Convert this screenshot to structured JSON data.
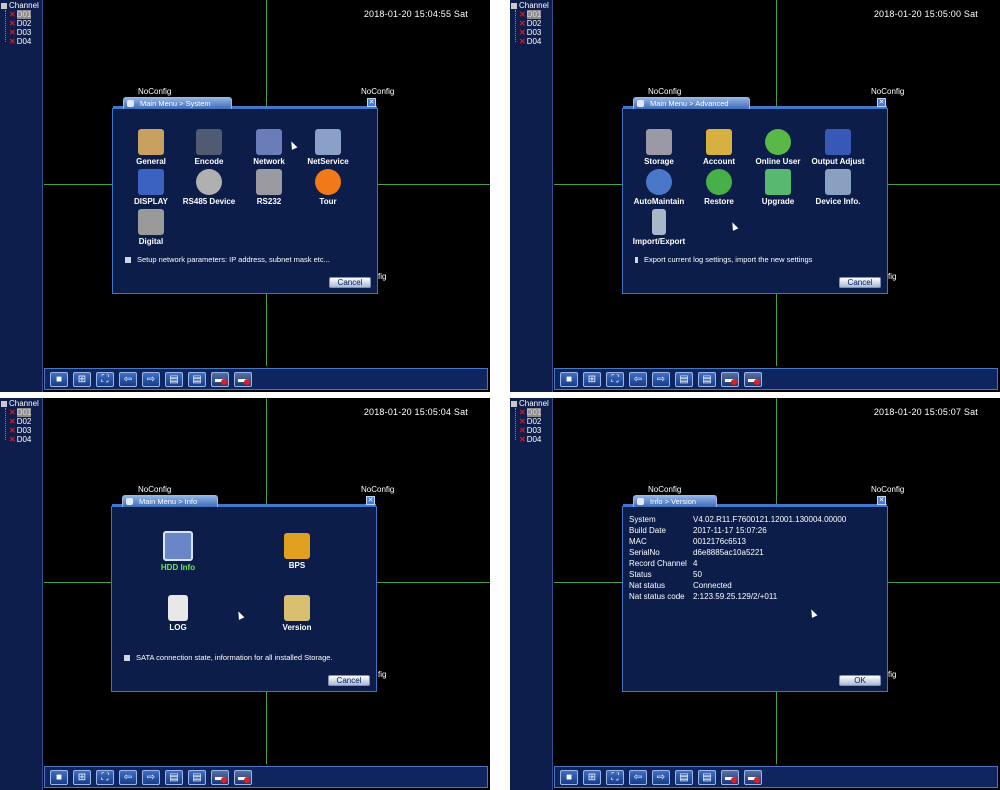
{
  "channel_panel": {
    "title": "Channel",
    "items": [
      {
        "label": "D01",
        "selected": true
      },
      {
        "label": "D02",
        "selected": false
      },
      {
        "label": "D03",
        "selected": false
      },
      {
        "label": "D04",
        "selected": false
      }
    ]
  },
  "grid": {
    "no_config": "NoConfig"
  },
  "taskbar": {
    "buttons": [
      {
        "name": "single-view-icon",
        "glyph": "■"
      },
      {
        "name": "quad-view-icon",
        "glyph": "⊞"
      },
      {
        "name": "fullscreen-icon",
        "glyph": "⛶"
      },
      {
        "name": "prev-icon",
        "glyph": "⇦"
      },
      {
        "name": "next-icon",
        "glyph": "⇨"
      },
      {
        "name": "record-icon",
        "glyph": "▤"
      },
      {
        "name": "playback-icon",
        "glyph": "▤"
      },
      {
        "name": "alarm-icon",
        "glyph": "▬"
      },
      {
        "name": "shutdown-icon",
        "glyph": "▬"
      }
    ]
  },
  "screens": [
    {
      "timestamp": "2018-01-20 15:04:55 Sat",
      "dialog_title": "Main Menu > System",
      "items": [
        {
          "label": "General",
          "icon": "tools-icon",
          "color": "#c8a060"
        },
        {
          "label": "Encode",
          "icon": "encode-icon",
          "color": "#505a70"
        },
        {
          "label": "Network",
          "icon": "network-icon",
          "color": "#6a7db8"
        },
        {
          "label": "NetService",
          "icon": "netservice-icon",
          "color": "#8aa0c8"
        },
        {
          "label": "DISPLAY",
          "icon": "display-icon",
          "color": "#3a62c0"
        },
        {
          "label": "RS485 Device",
          "icon": "camera-icon",
          "color": "#b0b0b0"
        },
        {
          "label": "RS232",
          "icon": "rs232-icon",
          "color": "#9a9aa0"
        },
        {
          "label": "Tour",
          "icon": "tour-icon",
          "color": "#f07a18"
        },
        {
          "label": "Digital",
          "icon": "digital-icon",
          "color": "#9a9a9a"
        }
      ],
      "hint": "Setup network parameters: IP address, subnet mask etc...",
      "button": "Cancel"
    },
    {
      "timestamp": "2018-01-20 15:05:00 Sat",
      "dialog_title": "Main Menu > Advanced",
      "items": [
        {
          "label": "Storage",
          "icon": "storage-icon",
          "color": "#9a9aa6"
        },
        {
          "label": "Account",
          "icon": "account-icon",
          "color": "#d8b040"
        },
        {
          "label": "Online User",
          "icon": "online-user-icon",
          "color": "#5ab848"
        },
        {
          "label": "Output Adjust",
          "icon": "output-adjust-icon",
          "color": "#3858b8"
        },
        {
          "label": "AutoMaintain",
          "icon": "automaintain-icon",
          "color": "#4a78c8"
        },
        {
          "label": "Restore",
          "icon": "restore-icon",
          "color": "#48b048"
        },
        {
          "label": "Upgrade",
          "icon": "upgrade-icon",
          "color": "#58b870"
        },
        {
          "label": "Device Info.",
          "icon": "device-info-icon",
          "color": "#8aa0c0"
        },
        {
          "label": "Import/Export",
          "icon": "import-export-icon",
          "color": "#a8b8c8"
        }
      ],
      "hint": "Export current log settings, import the new settings",
      "button": "Cancel"
    },
    {
      "timestamp": "2018-01-20 15:05:04 Sat",
      "dialog_title": "Main Menu > Info",
      "items": [
        {
          "label": "HDD Info",
          "icon": "hdd-info-icon",
          "color": "#6a86c8",
          "highlight": true
        },
        {
          "label": "BPS",
          "icon": "bps-icon",
          "color": "#e0a020"
        },
        {
          "label": "LOG",
          "icon": "log-icon",
          "color": "#e8e8e8"
        },
        {
          "label": "Version",
          "icon": "version-icon",
          "color": "#d8c070"
        }
      ],
      "hint": "SATA connection state, information for all installed Storage.",
      "button": "Cancel"
    },
    {
      "timestamp": "2018-01-20 15:05:07 Sat",
      "dialog_title": "Info > Version",
      "rows": [
        {
          "label": "System",
          "value": "V4.02.R11.F7600121.12001.130004.00000"
        },
        {
          "label": "Build Date",
          "value": "2017-11-17 15:07:26"
        },
        {
          "label": "MAC",
          "value": "0012176c6513"
        },
        {
          "label": "SerialNo",
          "value": "d6e8885ac10a5221"
        },
        {
          "label": "Record Channel",
          "value": "4"
        },
        {
          "label": "Status",
          "value": "50"
        },
        {
          "label": "Nat status",
          "value": "Connected"
        },
        {
          "label": "Nat status code",
          "value": "2:123.59.25.129/2/+011"
        }
      ],
      "button": "OK"
    }
  ]
}
